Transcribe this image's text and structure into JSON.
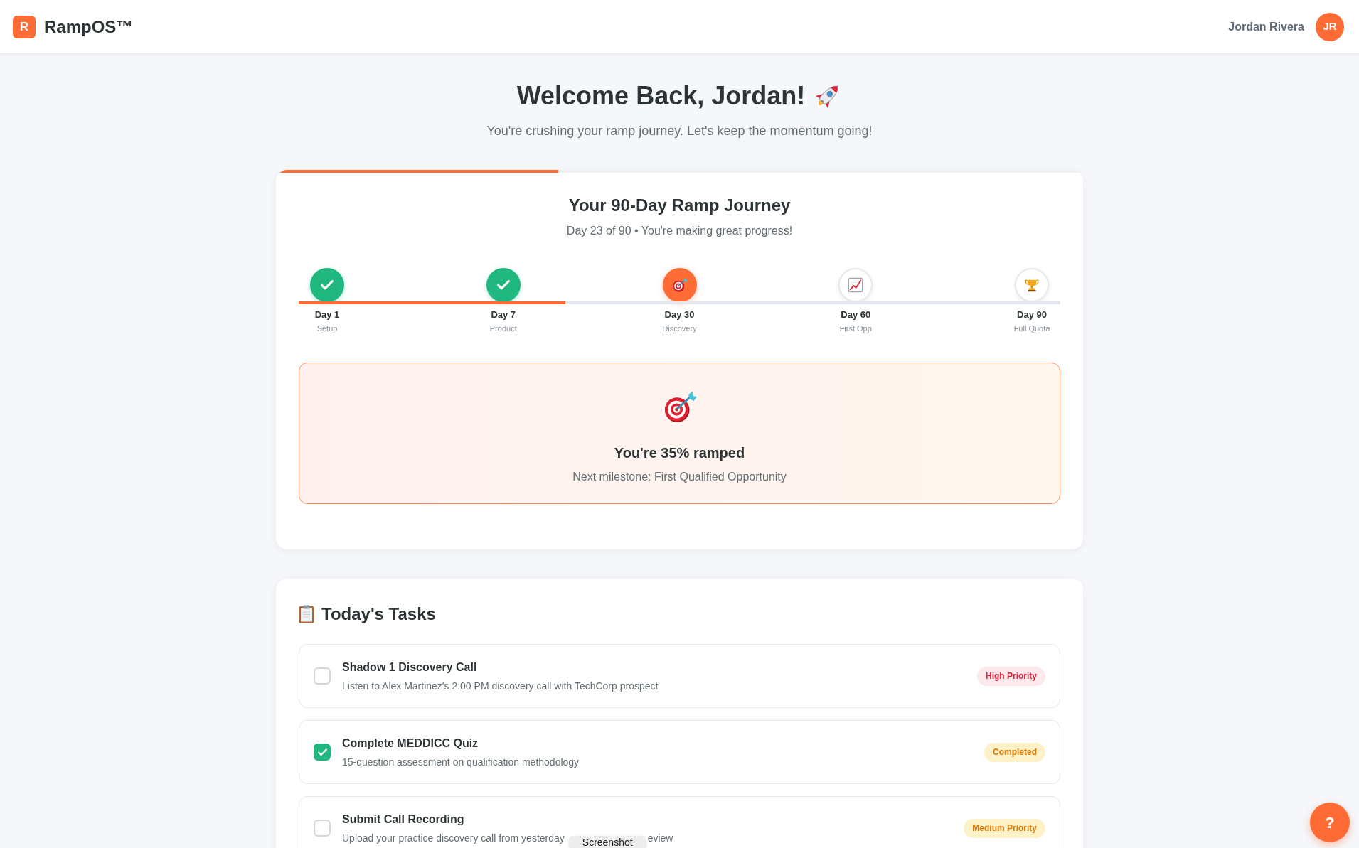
{
  "header": {
    "logo_letter": "R",
    "brand": "RampOS™",
    "user_name": "Jordan Rivera",
    "avatar_initials": "JR"
  },
  "welcome": {
    "title": "Welcome Back, Jordan!",
    "subtitle": "You're crushing your ramp journey. Let's keep the momentum going!"
  },
  "journey": {
    "level": 0.35,
    "title": "Your 90-Day Ramp Journey",
    "subtitle": "Day 23 of 90 • You're making great progress!",
    "timeline": {
      "level": 0.35,
      "milestones": [
        {
          "day": "Day 1",
          "label": "Setup",
          "done": true,
          "current": false
        },
        {
          "day": "Day 7",
          "label": "Product",
          "done": true,
          "current": false
        },
        {
          "day": "Day 30",
          "label": "Discovery",
          "done": false,
          "current": true
        },
        {
          "day": "Day 60",
          "label": "First Opp",
          "done": false,
          "current": false
        },
        {
          "day": "Day 90",
          "label": "Full Quota",
          "done": false,
          "current": false
        }
      ]
    },
    "ramp_status": {
      "title": "You're 35% ramped",
      "next_milestone": "Next milestone: First Qualified Opportunity"
    }
  },
  "tasks": {
    "title": "Today's Tasks",
    "items": [
      {
        "title": "Shadow 1 Discovery Call",
        "description": "Listen to Alex Martinez's 2:00 PM discovery call with TechCorp prospect",
        "checked": false,
        "badge": {
          "label": "High Priority",
          "kind": "high"
        }
      },
      {
        "title": "Complete MEDDICC Quiz",
        "description": "15-question assessment on qualification methodology",
        "checked": true,
        "badge": {
          "label": "Completed",
          "kind": "completed"
        }
      },
      {
        "title": "Submit Call Recording",
        "description": "Upload your practice discovery call from yesterday",
        "description_tail": "eview",
        "checked": false,
        "badge": {
          "label": "Medium Priority",
          "kind": "medium"
        }
      }
    ]
  },
  "overlay_tooltip": {
    "label": "Screenshot"
  },
  "help_button": {
    "label": "?"
  }
}
